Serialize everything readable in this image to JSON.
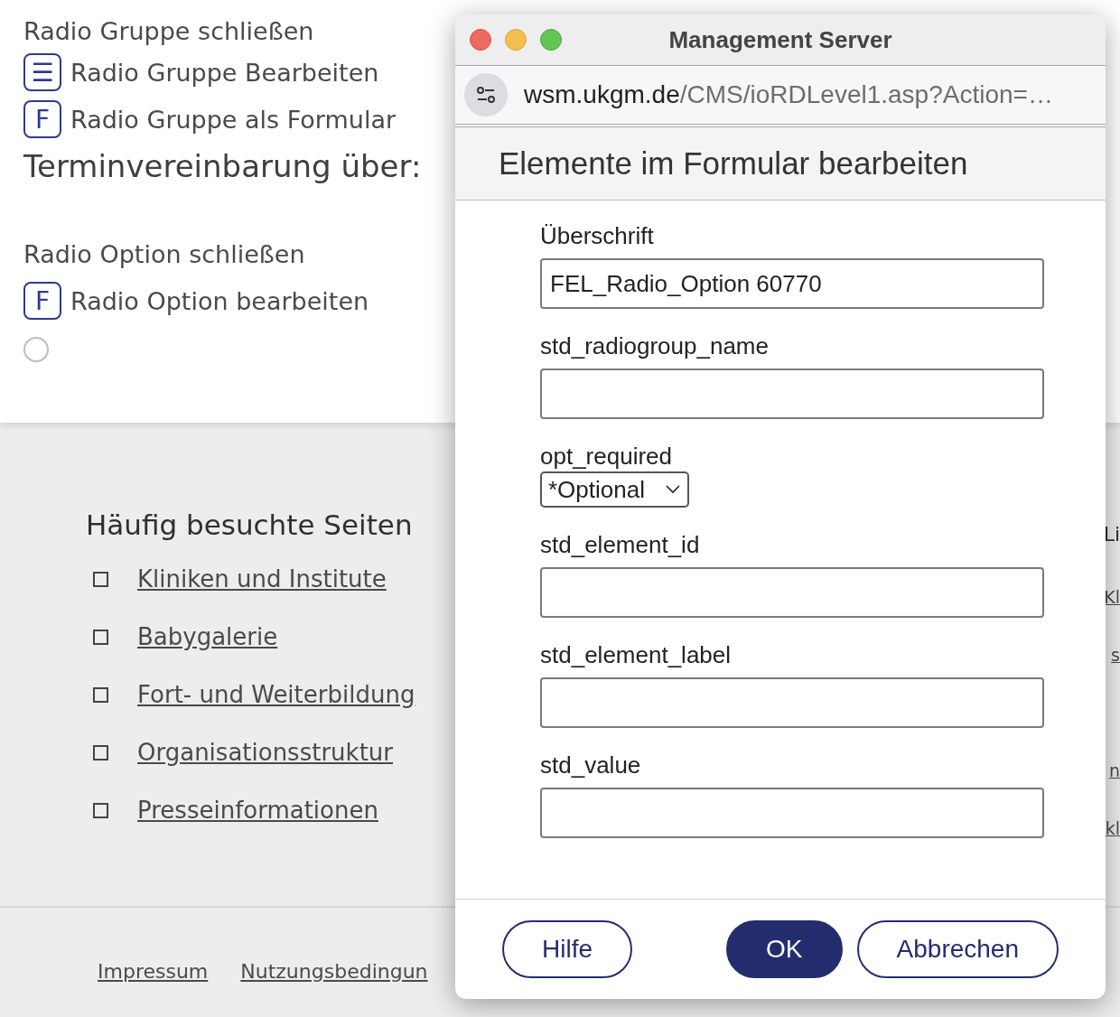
{
  "page": {
    "top_items": [
      {
        "kind": "text",
        "label": "Radio Gruppe schließen"
      },
      {
        "kind": "list-button",
        "icon": "☰",
        "label": "Radio Gruppe Bearbeiten"
      },
      {
        "kind": "form-button",
        "icon": "F",
        "label": "Radio Gruppe als Formular"
      },
      {
        "kind": "heading",
        "label": "Terminvereinbarung über:"
      },
      {
        "kind": "text",
        "label": "Radio Option schließen"
      },
      {
        "kind": "form-button",
        "icon": "F",
        "label": "Radio Option bearbeiten"
      },
      {
        "kind": "radio",
        "selected": false
      }
    ],
    "links_section": {
      "title": "Häufig besuchte Seiten",
      "links": [
        "Kliniken und Institute",
        "Babygalerie",
        "Fort- und Weiterbildung",
        "Organisationsstruktur",
        "Presseinformationen"
      ]
    },
    "right_column_fragments": [
      {
        "kind": "heading",
        "text": "Li"
      },
      {
        "kind": "link",
        "text": "Kl"
      },
      {
        "kind": "link",
        "text": "s"
      },
      {
        "kind": "gap"
      },
      {
        "kind": "link",
        "text": "n"
      },
      {
        "kind": "link",
        "text": "kl"
      }
    ],
    "footer_links": [
      "Impressum",
      "Nutzungsbedingun"
    ]
  },
  "dialog": {
    "window_title": "Management Server",
    "url_host": "wsm.ukgm.de",
    "url_path": "/CMS/ioRDLevel1.asp?Action=…",
    "heading": "Elemente im Formular bearbeiten",
    "fields": [
      {
        "kind": "text",
        "label": "Überschrift",
        "value": "FEL_Radio_Option 60770"
      },
      {
        "kind": "text",
        "label": "std_radiogroup_name"
      },
      {
        "kind": "select",
        "label": "opt_required",
        "value": "*Optional"
      },
      {
        "kind": "text",
        "label": "std_element_id"
      },
      {
        "kind": "text",
        "label": "std_element_label"
      },
      {
        "kind": "text",
        "label": "std_value"
      }
    ],
    "buttons": [
      {
        "label": "Hilfe",
        "primary": false
      },
      {
        "label": "OK",
        "primary": true
      },
      {
        "label": "Abbrechen",
        "primary": false
      }
    ]
  }
}
